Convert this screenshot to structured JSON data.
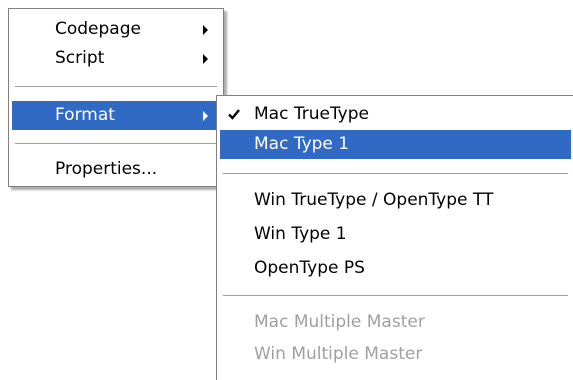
{
  "main_menu": {
    "items": [
      {
        "label": "Codepage"
      },
      {
        "label": "Script"
      },
      {
        "label": "Format"
      },
      {
        "label": "Properties..."
      }
    ]
  },
  "format_submenu": {
    "items": [
      {
        "label": "Mac TrueType",
        "checked": true
      },
      {
        "label": "Mac Type 1"
      },
      {
        "label": "Win TrueType / OpenType TT"
      },
      {
        "label": "Win Type 1"
      },
      {
        "label": "OpenType PS"
      },
      {
        "label": "Mac Multiple Master",
        "disabled": true
      },
      {
        "label": "Win Multiple Master",
        "disabled": true
      }
    ]
  },
  "colors": {
    "highlight": "#316ac5",
    "disabled_text": "#a0a0a0",
    "separator": "#a0a0a0"
  }
}
